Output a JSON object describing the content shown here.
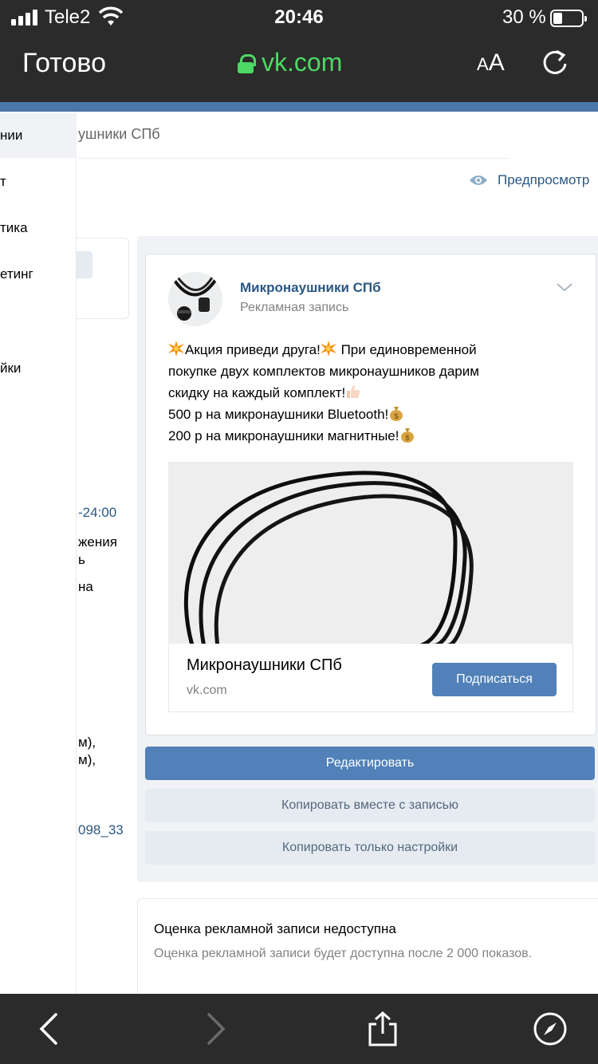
{
  "status_bar": {
    "carrier": "Tele2",
    "time": "20:46",
    "battery": "30 %"
  },
  "browser": {
    "done": "Готово",
    "url": "vk.com",
    "text_size": "AA",
    "url_color": "#4cd964"
  },
  "header": {
    "campaign_title": "ушники СПб",
    "preview": "Предпросмотр"
  },
  "sidebar": {
    "items": [
      {
        "label": "нии"
      },
      {
        "label": "т"
      },
      {
        "label": "тика"
      },
      {
        "label": "етинг"
      },
      {
        "label": "йки"
      }
    ]
  },
  "left_column": {
    "time_range": "-24:00",
    "line1": "жения",
    "line2": "ь",
    "line3": "на",
    "line4": "м),",
    "line5": "м),",
    "id_link": "098_33"
  },
  "post": {
    "author": "Микронаушники СПб",
    "subtitle": "Рекламная запись",
    "line1_a": "Акция приведи друга!",
    "line1_b": " При единовременной",
    "line2": "покупке двух комплектов микронаушников дарим",
    "line3": "скидку на каждый комплект!",
    "line4": "500 р на микронаушники Bluetooth!",
    "line5": "200 р на микронаушники магнитные!",
    "snippet_title": "Микронаушники СПб",
    "snippet_domain": "vk.com",
    "subscribe": "Подписаться"
  },
  "actions": {
    "edit": "Редактировать",
    "copy_with_post": "Копировать вместе с записью",
    "copy_settings": "Копировать только настройки"
  },
  "rating": {
    "title": "Оценка рекламной записи недоступна",
    "text": "Оценка рекламной записи будет доступна после 2 000 показов."
  },
  "colors": {
    "vk_blue": "#4a76a8",
    "button_blue": "#5181b8",
    "link": "#2a5885"
  }
}
